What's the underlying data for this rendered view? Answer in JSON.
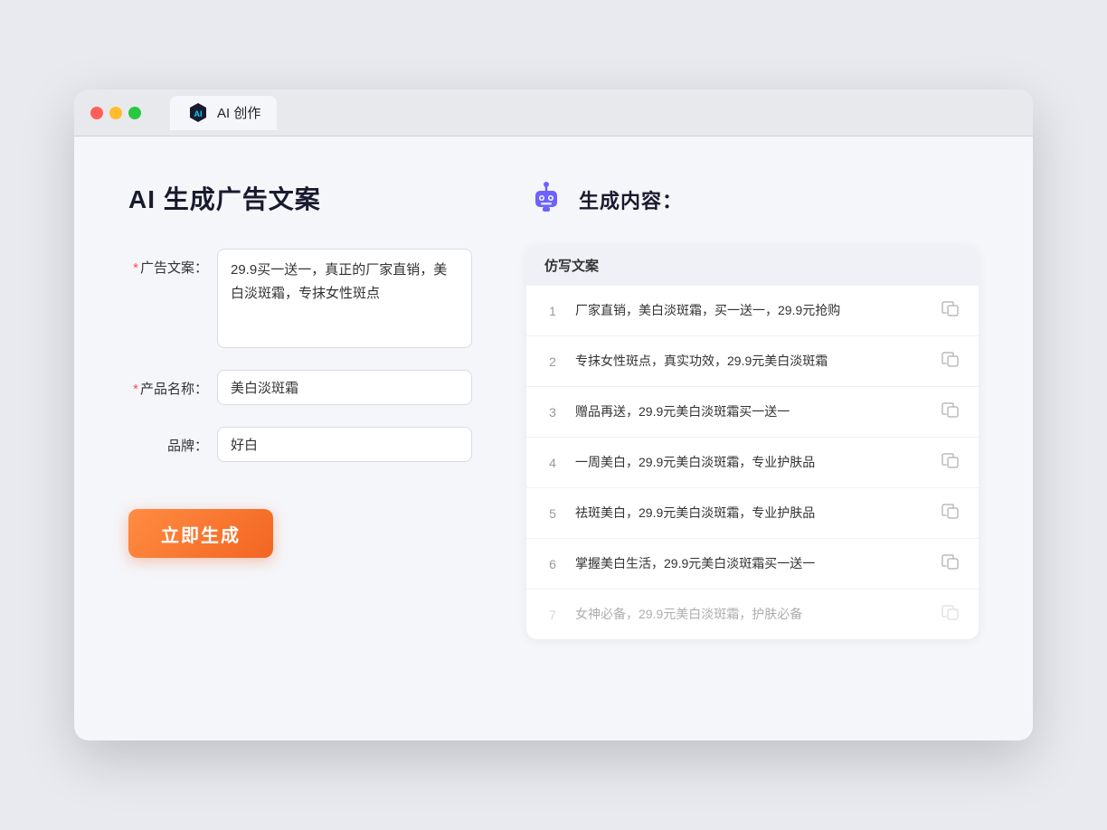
{
  "browser": {
    "tab_label": "AI 创作"
  },
  "page": {
    "title": "AI 生成广告文案",
    "right_title": "生成内容："
  },
  "form": {
    "ad_copy_label": "广告文案：",
    "ad_copy_required": "*",
    "ad_copy_value": "29.9买一送一，真正的厂家直销，美白淡斑霜，专抹女性斑点",
    "product_name_label": "产品名称：",
    "product_name_required": "*",
    "product_name_value": "美白淡斑霜",
    "brand_label": "品牌：",
    "brand_value": "好白",
    "generate_btn": "立即生成"
  },
  "results": {
    "header": "仿写文案",
    "items": [
      {
        "num": "1",
        "text": "厂家直销，美白淡斑霜，买一送一，29.9元抢购",
        "faded": false
      },
      {
        "num": "2",
        "text": "专抹女性斑点，真实功效，29.9元美白淡斑霜",
        "faded": false
      },
      {
        "num": "3",
        "text": "赠品再送，29.9元美白淡斑霜买一送一",
        "faded": false
      },
      {
        "num": "4",
        "text": "一周美白，29.9元美白淡斑霜，专业护肤品",
        "faded": false
      },
      {
        "num": "5",
        "text": "祛斑美白，29.9元美白淡斑霜，专业护肤品",
        "faded": false
      },
      {
        "num": "6",
        "text": "掌握美白生活，29.9元美白淡斑霜买一送一",
        "faded": false
      },
      {
        "num": "7",
        "text": "女神必备，29.9元美白淡斑霜，护肤必备",
        "faded": true
      }
    ]
  }
}
